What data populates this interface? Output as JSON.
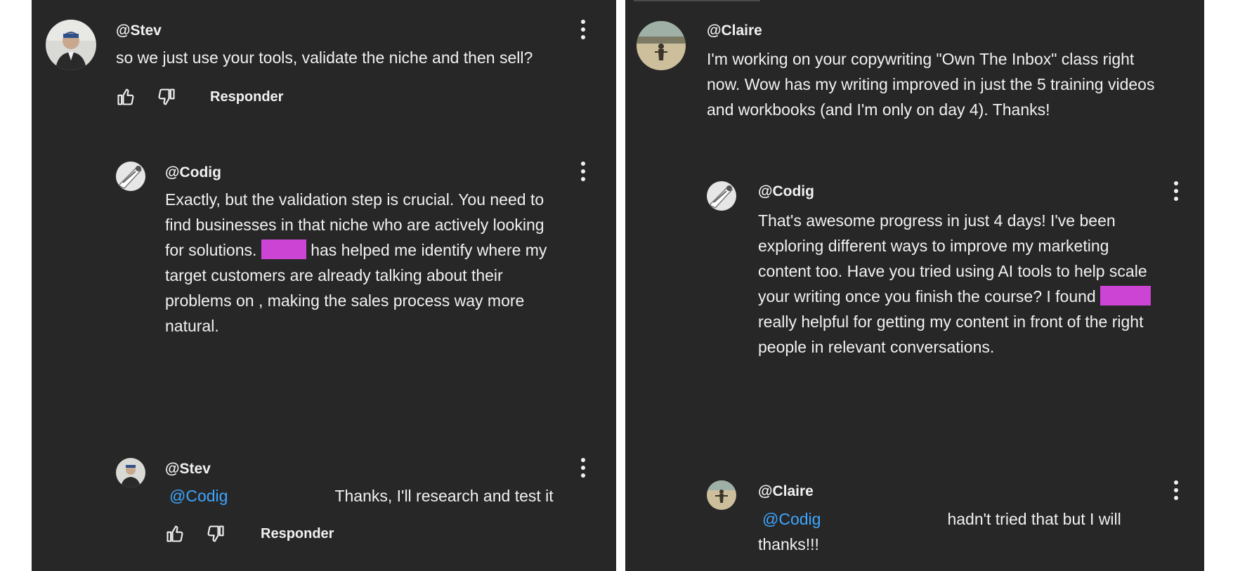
{
  "left_thread": {
    "comment": {
      "handle": "@Stev",
      "text": "so we just use your tools, validate the niche and then sell?",
      "reply_label": "Responder",
      "icons": [
        "like-icon",
        "dislike-icon",
        "more-options-icon"
      ]
    },
    "reply_1": {
      "handle": "@Codig",
      "lines": [
        "Exactly, but the validation step is crucial. You need to",
        "find businesses in that niche who are actively looking",
        "for solutions.",
        "has helped me identify where my",
        "target customers are already talking about their",
        "problems on , making the sales process way more",
        "natural."
      ]
    },
    "reply_2": {
      "handle": "@Stev",
      "mention": "@Codig",
      "text": "Thanks, I'll research and test it",
      "reply_label": "Responder"
    }
  },
  "right_thread": {
    "comment": {
      "handle": "@Claire",
      "lines": [
        "I'm working on your copywriting \"Own The Inbox\" class right",
        "now. Wow has my writing improved in just the 5 training videos",
        "and workbooks (and I'm only on day 4). Thanks!"
      ]
    },
    "reply_1": {
      "handle": "@Codig",
      "lines": [
        "That's awesome progress in just 4 days! I've been",
        "exploring different ways to improve my marketing",
        "content too. Have you tried using AI tools to help scale",
        "your writing once you finish the course? I found",
        "really helpful for getting my content in front of the right",
        "people in relevant conversations."
      ]
    },
    "reply_2": {
      "handle": "@Claire",
      "mention": "@Codig",
      "text_line1": "hadn't tried that but I will",
      "text_line2": "thanks!!!"
    }
  },
  "colors": {
    "background": "#272727",
    "text": "#f1f1f1",
    "mention": "#3ea6ff",
    "redaction": "#cc44d4"
  }
}
